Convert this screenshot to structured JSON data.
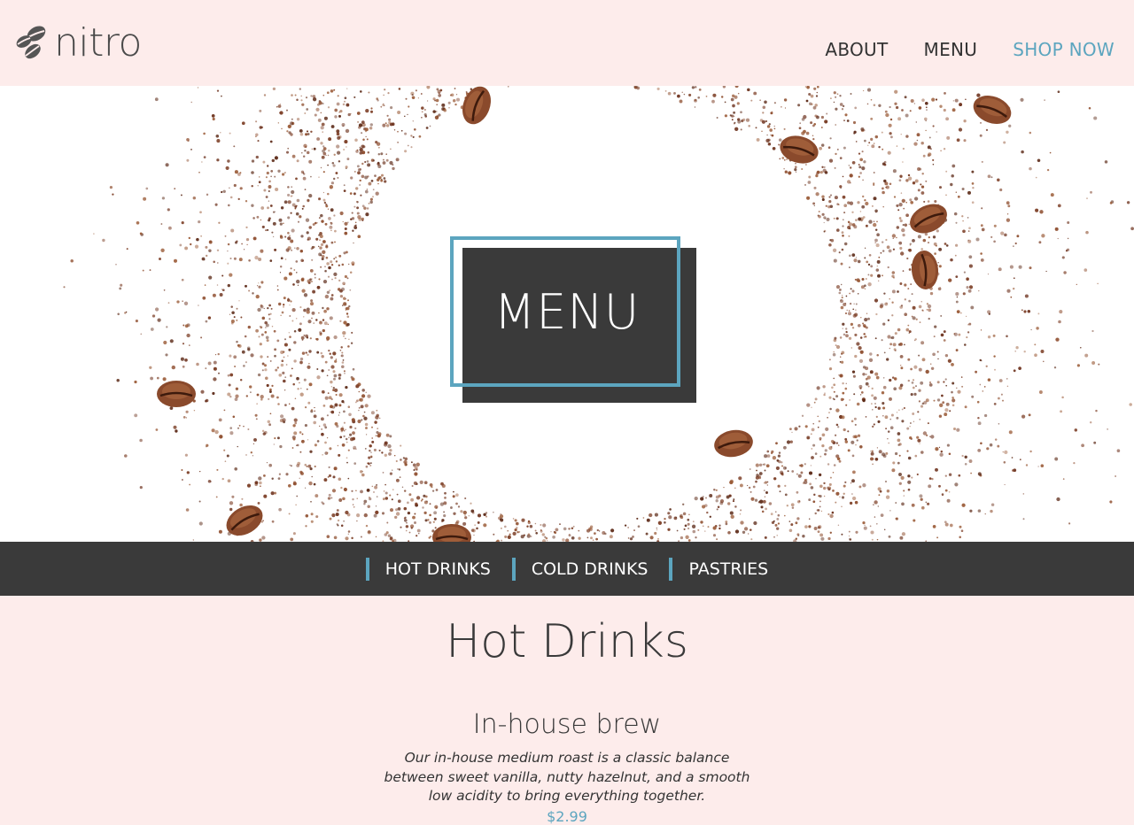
{
  "brand": {
    "name": "nitro",
    "logo_icon": "coffee-beans-icon"
  },
  "nav": {
    "items": [
      {
        "label": "ABOUT"
      },
      {
        "label": "MENU"
      },
      {
        "label": "SHOP NOW"
      }
    ]
  },
  "hero": {
    "title": "MENU"
  },
  "categories": [
    {
      "label": "HOT DRINKS"
    },
    {
      "label": "COLD DRINKS"
    },
    {
      "label": "PASTRIES"
    }
  ],
  "section": {
    "title": "Hot Drinks",
    "items": [
      {
        "name": "In-house brew",
        "description": "Our in-house medium roast is a classic balance between sweet vanilla, nutty hazelnut, and a smooth low acidity to bring everything together.",
        "price": "$2.99"
      }
    ]
  },
  "colors": {
    "accent": "#5ca5bf",
    "dark": "#3a3a3a",
    "background": "#fdeceb",
    "coffee": "#7a3b22"
  }
}
